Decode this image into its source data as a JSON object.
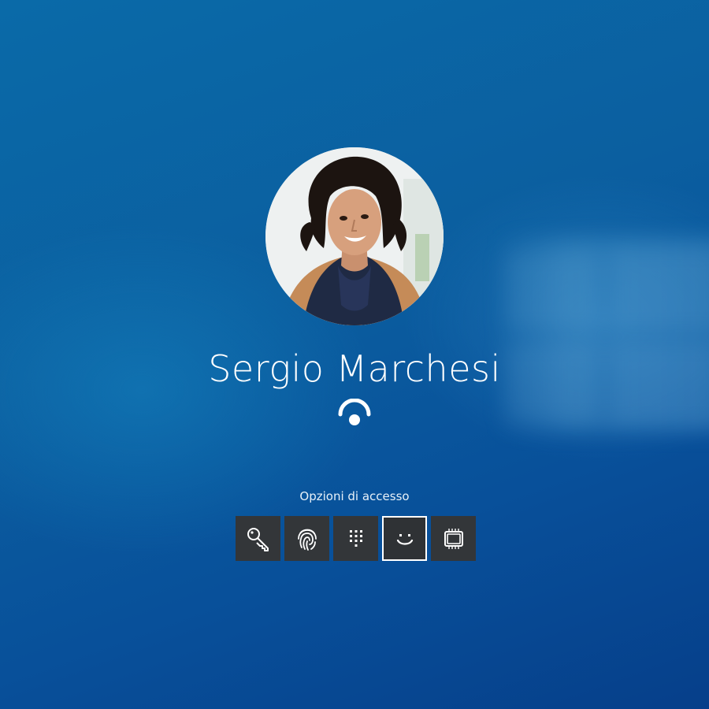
{
  "user": {
    "name": "Sergio Marchesi"
  },
  "signin": {
    "options_label": "Opzioni di accesso",
    "options": [
      {
        "id": "password",
        "icon": "key-icon",
        "selected": false
      },
      {
        "id": "fingerprint",
        "icon": "fingerprint-icon",
        "selected": false
      },
      {
        "id": "pin",
        "icon": "pin-keypad-icon",
        "selected": false
      },
      {
        "id": "face",
        "icon": "smiley-face-icon",
        "selected": true
      },
      {
        "id": "security-key",
        "icon": "security-key-icon",
        "selected": false
      }
    ]
  },
  "colors": {
    "background": "#0b5fa0",
    "tile": "#333639",
    "selected_border": "#ffffff",
    "text": "#ffffff"
  }
}
